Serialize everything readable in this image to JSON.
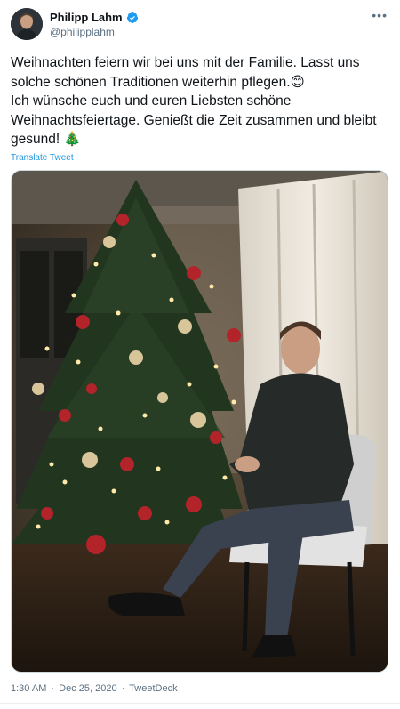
{
  "author": {
    "name": "Philipp Lahm",
    "handle": "@philipplahm",
    "verified": true,
    "avatar_icon": "profile-avatar"
  },
  "tweet": {
    "text": "Weihnachten feiern wir bei uns mit der Familie. Lasst uns solche schönen Traditionen weiterhin pflegen.😊\nIch wünsche euch und euren Liebsten schöne Weihnachtsfeiertage. Genießt die Zeit zusammen und bleibt gesund! 🎄",
    "translate_label": "Translate Tweet",
    "more_icon": "more-options-icon"
  },
  "media": {
    "description_icon": "photo"
  },
  "meta": {
    "time": "1:30 AM",
    "separator": "·",
    "date": "Dec 25, 2020",
    "source": "TweetDeck"
  },
  "colors": {
    "link": "#1b95e0",
    "secondary_text": "#5b7083",
    "verified": "#1d9bf0"
  }
}
